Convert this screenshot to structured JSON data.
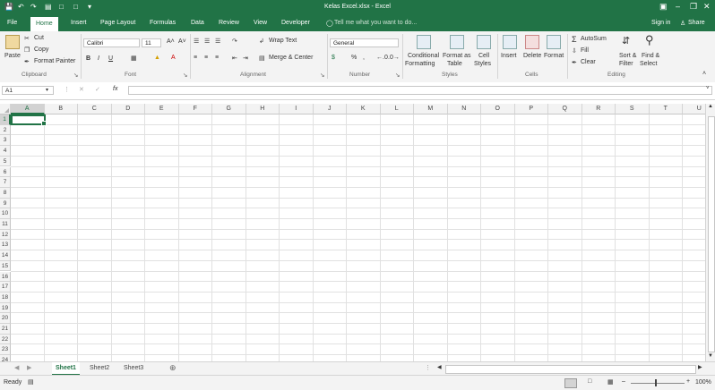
{
  "window": {
    "title": "Kelas Excel.xlsx - Excel"
  },
  "tabs": [
    {
      "label": "File"
    },
    {
      "label": "Home"
    },
    {
      "label": "Insert"
    },
    {
      "label": "Page Layout"
    },
    {
      "label": "Formulas"
    },
    {
      "label": "Data"
    },
    {
      "label": "Review"
    },
    {
      "label": "View"
    },
    {
      "label": "Developer"
    }
  ],
  "tell_me": "Tell me what you want to do...",
  "account": {
    "signin": "Sign in",
    "share": "Share"
  },
  "clipboard": {
    "paste": "Paste",
    "cut": "Cut",
    "copy": "Copy",
    "format_painter": "Format Painter",
    "group": "Clipboard"
  },
  "font": {
    "name": "Calibri",
    "size": "11",
    "bold": "B",
    "italic": "I",
    "underline": "U",
    "group": "Font"
  },
  "alignment": {
    "wrap": "Wrap Text",
    "merge": "Merge & Center",
    "group": "Alignment"
  },
  "number": {
    "format": "General",
    "percent": "%",
    "comma": ",",
    "group": "Number"
  },
  "styles": {
    "conditional": "Conditional",
    "conditional2": "Formatting",
    "format_as": "Format as",
    "format_as2": "Table",
    "cell": "Cell",
    "cell2": "Styles",
    "group": "Styles"
  },
  "cells": {
    "insert": "Insert",
    "delete": "Delete",
    "format": "Format",
    "group": "Cells"
  },
  "editing": {
    "autosum": "AutoSum",
    "fill": "Fill",
    "clear": "Clear",
    "sort": "Sort &",
    "sort2": "Filter",
    "find": "Find &",
    "find2": "Select",
    "group": "Editing"
  },
  "formula_bar": {
    "name_box": "A1",
    "fx": "fx",
    "formula": ""
  },
  "columns": [
    "A",
    "B",
    "C",
    "D",
    "E",
    "F",
    "G",
    "H",
    "I",
    "J",
    "K",
    "L",
    "M",
    "N",
    "O",
    "P",
    "Q",
    "R",
    "S",
    "T",
    "U"
  ],
  "rows": [
    "1",
    "2",
    "3",
    "4",
    "5",
    "6",
    "7",
    "8",
    "9",
    "10",
    "11",
    "12",
    "13",
    "14",
    "15",
    "16",
    "17",
    "18",
    "19",
    "20",
    "21",
    "22",
    "23",
    "24"
  ],
  "sheets": [
    {
      "label": "Sheet1"
    },
    {
      "label": "Sheet2"
    },
    {
      "label": "Sheet3"
    }
  ],
  "status": {
    "ready": "Ready",
    "zoom": "100%"
  },
  "colors": {
    "accent": "#217346"
  }
}
